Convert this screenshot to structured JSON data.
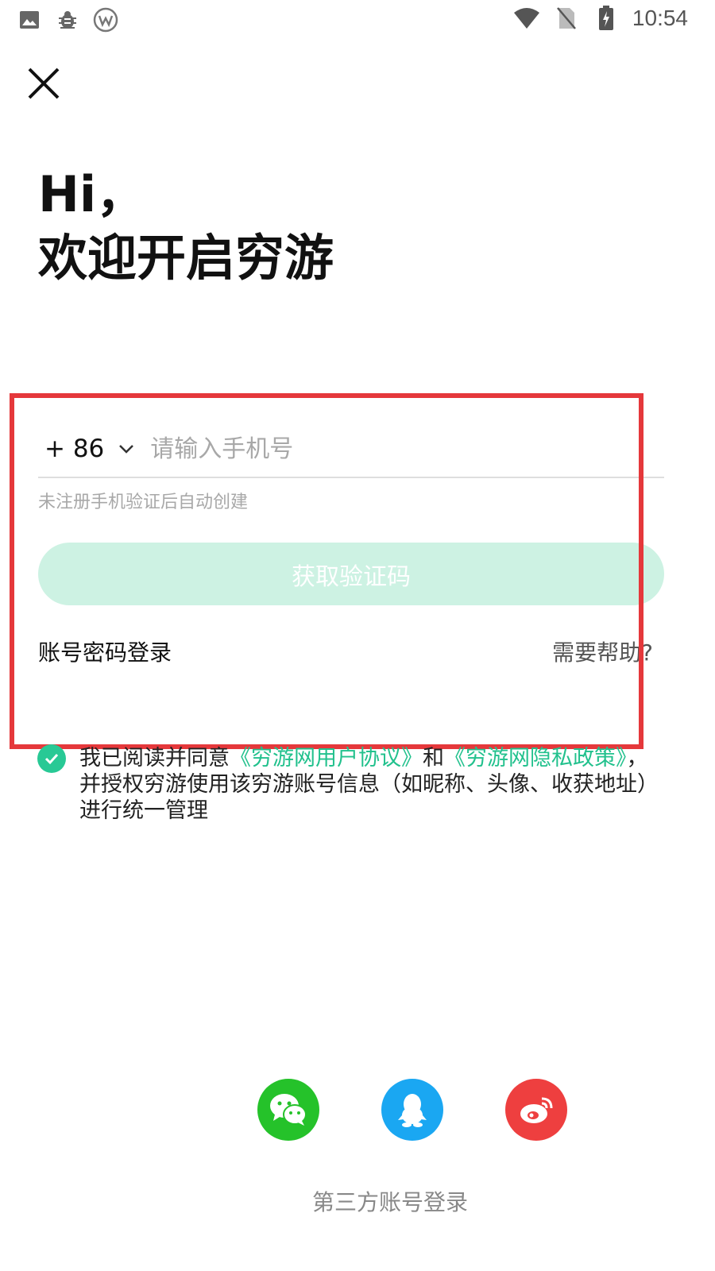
{
  "status_bar": {
    "time": "10:54",
    "icons": [
      "image-icon",
      "bug-icon",
      "w-logo-icon",
      "wifi-icon",
      "no-sim-icon",
      "battery-icon"
    ]
  },
  "greeting": {
    "line1": "Hi，",
    "line2": "欢迎开启穷游"
  },
  "login_form": {
    "country_code": "+ 86",
    "phone_placeholder": "请输入手机号",
    "phone_value": "",
    "hint": "未注册手机验证后自动创建",
    "get_code_label": "获取验证码",
    "password_login_label": "账号密码登录",
    "help_label": "需要帮助?"
  },
  "agreement": {
    "prefix": "我已阅读并同意",
    "user_agreement": "《穷游网用户协议》",
    "and": "和",
    "privacy_policy": "《穷游网隐私政策》",
    "suffix": "，并授权穷游使用该穷游账号信息（如昵称、头像、收获地址）进行统一管理",
    "checked": true
  },
  "third_party": {
    "label": "第三方账号登录",
    "providers": [
      "wechat",
      "qq",
      "weibo"
    ]
  },
  "colors": {
    "accent": "#22c18d",
    "button_disabled": "#cdf2e3",
    "highlight": "#e5383b",
    "wechat": "#25c22a",
    "qq": "#1aa7f2",
    "weibo": "#ee3f3f"
  }
}
